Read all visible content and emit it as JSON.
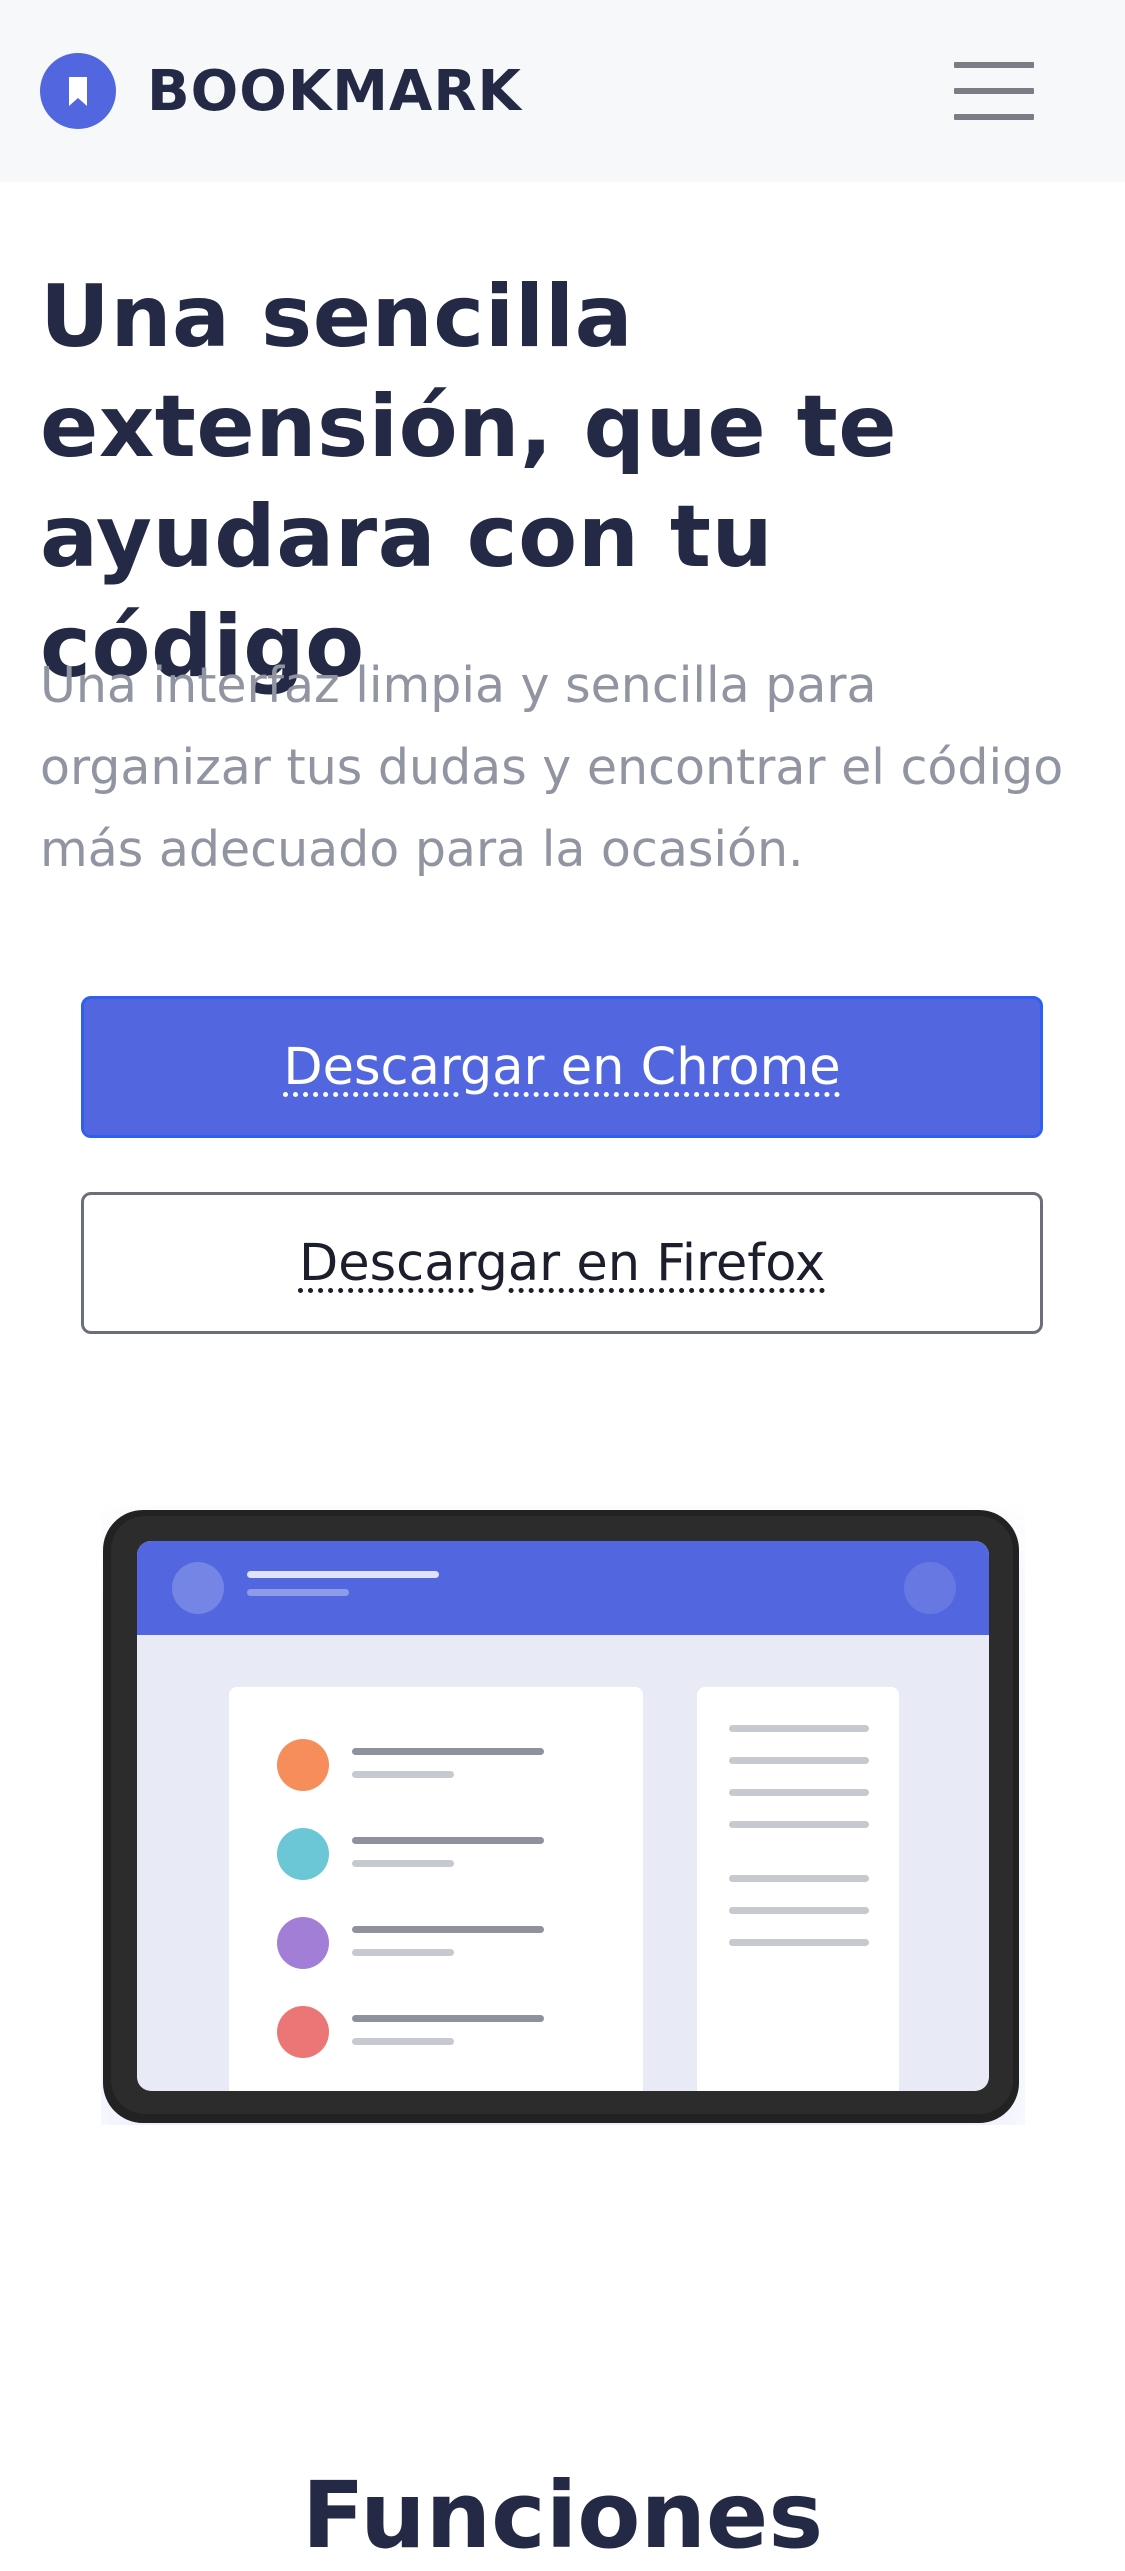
{
  "header": {
    "brand": "BOOKMARK",
    "logo_icon": "bookmark-icon",
    "menu_icon": "hamburger-menu-icon"
  },
  "hero": {
    "title": "Una sencilla extensión, que te ayudara con tu código",
    "description": "Una interfaz limpia y sencilla para organizar tus dudas y encontrar el código más adecuado para la ocasión.",
    "primary_button": "Descargar en Chrome",
    "secondary_button": "Descargar en Firefox"
  },
  "features": {
    "title": "Funciones"
  },
  "colors": {
    "accent": "#5267df",
    "heading": "#242a45",
    "body_text": "#9194a1",
    "header_bg": "#f7f8fa",
    "dot_orange": "#f68d5a",
    "dot_teal": "#6bc6d6",
    "dot_purple": "#a27ed6",
    "dot_red": "#ea7676"
  }
}
